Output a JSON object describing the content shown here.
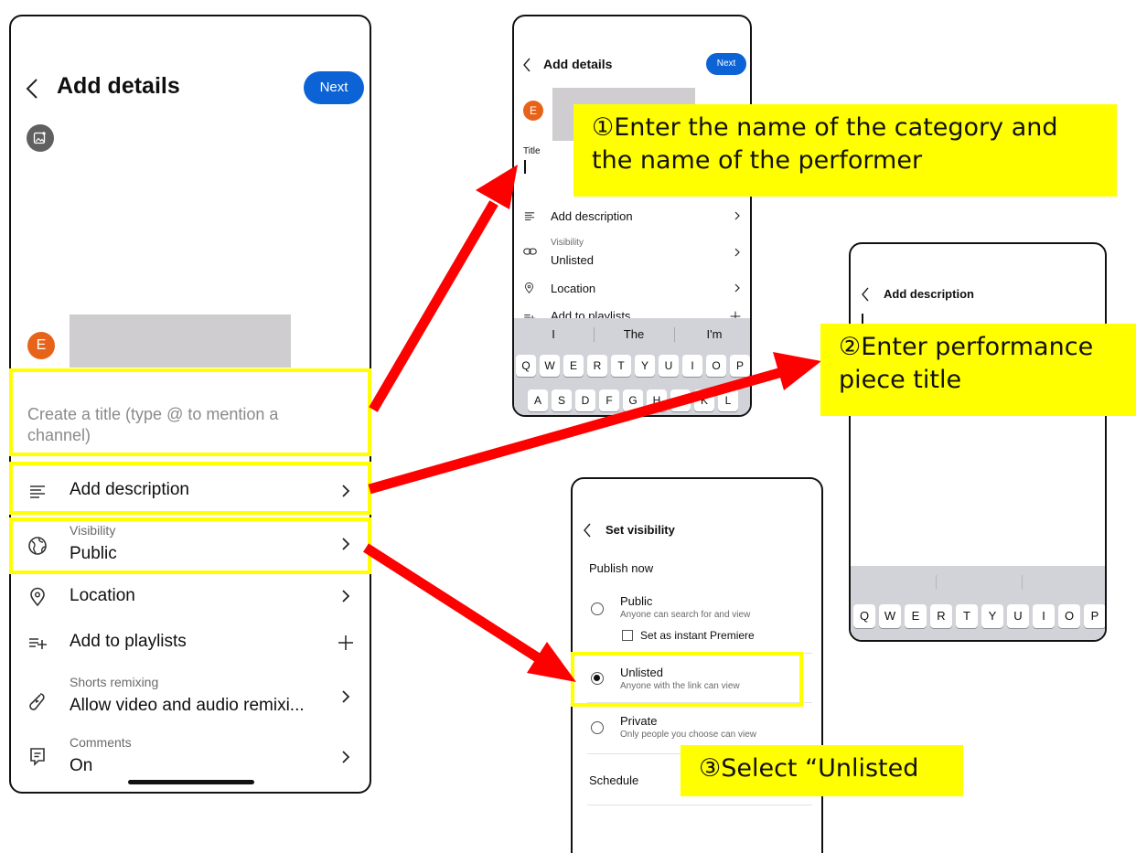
{
  "phone_main": {
    "title": "Add details",
    "next_label": "Next",
    "avatar_letter": "E",
    "title_placeholder": "Create a title (type @ to mention a channel)",
    "rows": {
      "description": {
        "label": "Add description"
      },
      "visibility": {
        "sub": "Visibility",
        "label": "Public"
      },
      "location": {
        "label": "Location"
      },
      "playlists": {
        "label": "Add to playlists"
      },
      "remixing": {
        "sub": "Shorts remixing",
        "label": "Allow video and audio remixi..."
      },
      "comments": {
        "sub": "Comments",
        "label": "On"
      }
    }
  },
  "phone_title": {
    "title": "Add details",
    "next_label": "Next",
    "avatar_letter": "E",
    "title_label": "Title",
    "rows": {
      "description": {
        "label": "Add description"
      },
      "visibility": {
        "sub": "Visibility",
        "label": "Unlisted"
      },
      "location": {
        "label": "Location"
      },
      "playlists": {
        "label": "Add to playlists"
      }
    },
    "suggestions": [
      "I",
      "The",
      "I'm"
    ],
    "keys_row1": [
      "Q",
      "W",
      "E",
      "R",
      "T",
      "Y",
      "U",
      "I",
      "O",
      "P"
    ],
    "keys_row2": [
      "A",
      "S",
      "D",
      "F",
      "G",
      "H",
      "J",
      "K",
      "L"
    ]
  },
  "phone_description": {
    "title": "Add description",
    "keys_row1": [
      "Q",
      "W",
      "E",
      "R",
      "T",
      "Y",
      "U",
      "I",
      "O",
      "P"
    ]
  },
  "phone_visibility": {
    "title": "Set visibility",
    "publish_now": "Publish now",
    "public": {
      "label": "Public",
      "sub": "Anyone can search for and view"
    },
    "premiere": {
      "label": "Set as instant Premiere"
    },
    "unlisted": {
      "label": "Unlisted",
      "sub": "Anyone with the link can view"
    },
    "private": {
      "label": "Private",
      "sub": "Only people you choose can view"
    },
    "schedule": "Schedule"
  },
  "callouts": {
    "step1": "①Enter the name of the category and the name of the performer",
    "step2": "②Enter performance piece title",
    "step3": "③Select “Unlisted"
  },
  "colors": {
    "highlight": "#ffff00",
    "arrow": "#ff0000",
    "accent": "#0b63d6",
    "avatar": "#e8631a"
  }
}
